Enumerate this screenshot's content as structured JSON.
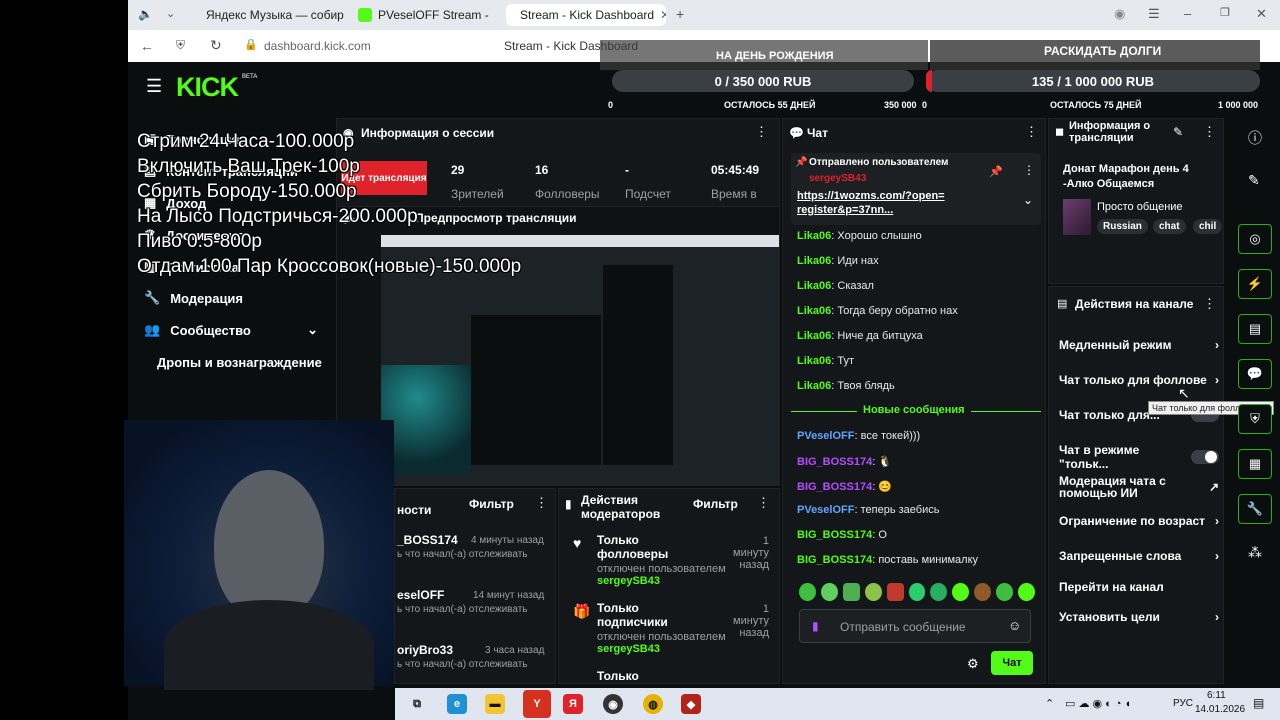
{
  "browser": {
    "tabs": [
      {
        "label": "Яндекс Музыка — собира",
        "color": "#ffcc00"
      },
      {
        "label": "PVeselOFF Stream -",
        "color": "#53fc18"
      },
      {
        "label": "Stream - Kick Dashboard",
        "color": "#53fc18"
      }
    ],
    "url": "dashboard.kick.com",
    "page_title": "Stream - Kick Dashboard"
  },
  "kick": {
    "logo": "KICK",
    "logo_sup": "BETA"
  },
  "goals": {
    "left": {
      "title": "НА ДЕНЬ РОЖДЕНИЯ",
      "value": "0 / 350 000 RUB",
      "min": "0",
      "remaining": "ОСТАЛОСЬ 55 ДНЕЙ",
      "max": "350 000",
      "progress": 0
    },
    "right": {
      "title": "РАСКИДАТЬ ДОЛГИ",
      "value": "135 / 1 000 000 RUB",
      "min": "0",
      "remaining": "ОСТАЛОСЬ 75 ДНЕЙ",
      "max": "1 000 000",
      "progress": 0.000135
    }
  },
  "sidebar": {
    "items": [
      {
        "label": "Трансляция"
      },
      {
        "label": "Контент трансляции"
      },
      {
        "label": "Доход"
      },
      {
        "label": "Достижения"
      },
      {
        "label": "Статистика"
      },
      {
        "label": "Модерация"
      },
      {
        "label": "Сообщество"
      },
      {
        "label": "Дропы и вознаграждение"
      }
    ]
  },
  "overlay_lines": [
    "Стрим 24 Часа-100.000р",
    "Включить Ваш Трек-100р",
    "Сбрить Бороду-150.000р",
    "На Лысо Подстричься-200.000р",
    "Пиво 0.5-800р",
    "Отдам 100 Пар Кроссовок(новые)-150.000р"
  ],
  "session": {
    "title": "Информация о сессии",
    "live_label": "Идет трансляция",
    "stats": [
      {
        "value": "29",
        "label": "Зрителей"
      },
      {
        "value": "16",
        "label": "Фолловеры"
      },
      {
        "value": "-",
        "label": "Подсчет"
      },
      {
        "value": "05:45:49",
        "label": "Время в"
      }
    ],
    "preview_title": "Предпросмотр трансляции"
  },
  "chat": {
    "title": "Чат",
    "pinned_label": "Отправлено пользователем",
    "pinned_user": "sergeySB43",
    "pinned_link": "https://1wozms.com/?open=register&p=37nn...",
    "messages_before": [
      {
        "user": "Lika06",
        "text": "Хорошо слышно"
      },
      {
        "user": "Lika06",
        "text": "Иди нах"
      },
      {
        "user": "Lika06",
        "text": "Сказал"
      },
      {
        "user": "Lika06",
        "text": "Тогда беру обратно нах"
      },
      {
        "user": "Lika06",
        "text": "Ниче да битцуха"
      },
      {
        "user": "Lika06",
        "text": "Тут"
      },
      {
        "user": "Lika06",
        "text": "Твоя блядь"
      }
    ],
    "new_messages_label": "Новые сообщения",
    "messages_after": [
      {
        "user": "PVeselOFF",
        "text": "все токей)))",
        "color": "blue"
      },
      {
        "user": "BIG_BOSS174",
        "text": "🐧",
        "color": "purple"
      },
      {
        "user": "BIG_BOSS174",
        "text": "😊",
        "color": "purple"
      },
      {
        "user": "PVeselOFF",
        "text": "теперь заебись",
        "color": "blue"
      },
      {
        "user": "BIG_BOSS174",
        "text": "О",
        "color": "green"
      },
      {
        "user": "BIG_BOSS174",
        "text": "поставь минималку",
        "color": "green"
      }
    ],
    "input_placeholder": "Отправить сообщение",
    "send_label": "Чат"
  },
  "activity": {
    "title": "ности",
    "filter": "Фильтр",
    "rows": [
      {
        "user": "_BOSS174",
        "time": "4 минуты назад",
        "text": "ь что начал(-а) отслеживать"
      },
      {
        "user": "eselOFF",
        "time": "14 минут назад",
        "text": "ь что начал(-а) отслеживать"
      },
      {
        "user": "oriyBro33",
        "time": "3 часа назад",
        "text": "ь что начал(-а) отслеживать"
      }
    ]
  },
  "mod_actions": {
    "title": "Действия модераторов",
    "filter": "Фильтр",
    "rows": [
      {
        "title": "Только фолловеры",
        "time": "1 минуту назад",
        "sub": "отключен пользователем",
        "user": "sergeySB43"
      },
      {
        "title": "Только подписчики",
        "time": "1 минуту назад",
        "sub": "отключен пользователем",
        "user": "sergeySB43"
      },
      {
        "title": "Только",
        "time": "",
        "sub": "",
        "user": ""
      }
    ]
  },
  "stream_info": {
    "title": "Информация о трансляции",
    "stream_title": "Донат Марафон день 4 -Алко Общаемся",
    "category": "Просто общение",
    "tags": [
      "Russian",
      "chat",
      "chil"
    ]
  },
  "channel_actions": {
    "title": "Действия на канале",
    "items": [
      {
        "label": "Медленный режим",
        "control": "chevron"
      },
      {
        "label": "Чат только для фоллове",
        "control": "chevron"
      },
      {
        "label": "Чат только для...",
        "control": "toggle"
      },
      {
        "label": "Чат в режиме \"тольк...",
        "control": "toggle"
      },
      {
        "label": "Модерация чата с помощью ИИ",
        "control": "external"
      },
      {
        "label": "Ограничение по возраст",
        "control": "chevron"
      },
      {
        "label": "Запрещенные слова",
        "control": "chevron"
      },
      {
        "label": "Перейти на канал",
        "control": "none"
      },
      {
        "label": "Установить цели",
        "control": "chevron"
      }
    ],
    "tooltip": "Чат только для фолловеров"
  },
  "taskbar": {
    "lang": "РУС",
    "time": "6:11",
    "date": "14.01.2026"
  }
}
